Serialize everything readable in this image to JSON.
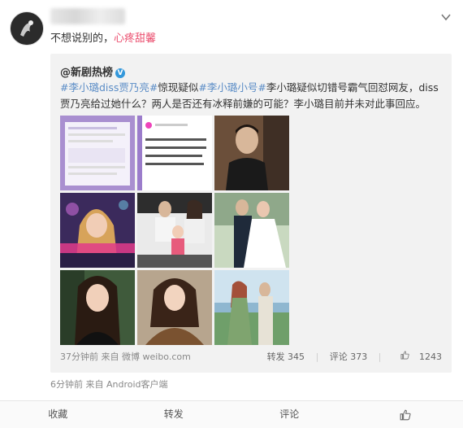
{
  "post": {
    "text": "不想说别的，",
    "highlight": "心疼甜馨",
    "collapse_icon": "chevron-down-icon"
  },
  "repost": {
    "author": "@新剧热榜",
    "verified": "V",
    "tag1": "#李小璐diss贾乃亮#",
    "text1": "惊现疑似",
    "tag2": "#李小璐小号#",
    "text2": "李小璐疑似切错号霸气回怼网友，diss贾乃亮给过她什么？两人是否还有冰释前嫌的可能？李小璐目前并未对此事回应。",
    "images": [
      {
        "name": "screenshot-1"
      },
      {
        "name": "screenshot-2"
      },
      {
        "name": "photo-man"
      },
      {
        "name": "photo-tv-show"
      },
      {
        "name": "photo-family"
      },
      {
        "name": "photo-wedding"
      },
      {
        "name": "photo-portrait"
      },
      {
        "name": "photo-woman-coat"
      },
      {
        "name": "photo-couple-beach"
      }
    ],
    "time": "37分钟前",
    "source": "来自 微博 weibo.com",
    "reposts": "转发 345",
    "comments": "评论 373",
    "likes": "1243"
  },
  "meta": {
    "time": "6分钟前",
    "source": "来自 Android客户端"
  },
  "actions": {
    "favorite": "收藏",
    "repost": "转发",
    "comment": "评论",
    "like_icon": "thumbs-up-icon"
  }
}
